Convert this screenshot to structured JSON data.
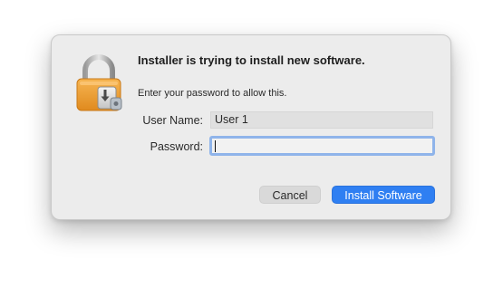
{
  "dialog": {
    "icon": "lock-icon",
    "title": "Installer is trying to install new software.",
    "subtitle": "Enter your password to allow this.",
    "fields": {
      "username": {
        "label": "User Name:",
        "value": "User 1"
      },
      "password": {
        "label": "Password:",
        "value": ""
      }
    },
    "buttons": {
      "cancel": "Cancel",
      "install": "Install Software"
    }
  },
  "colors": {
    "accent": "#2f7ff2",
    "focus_ring": "#8fb4ea",
    "lock_gold": "#f0a23a",
    "dialog_bg": "#ececec"
  }
}
